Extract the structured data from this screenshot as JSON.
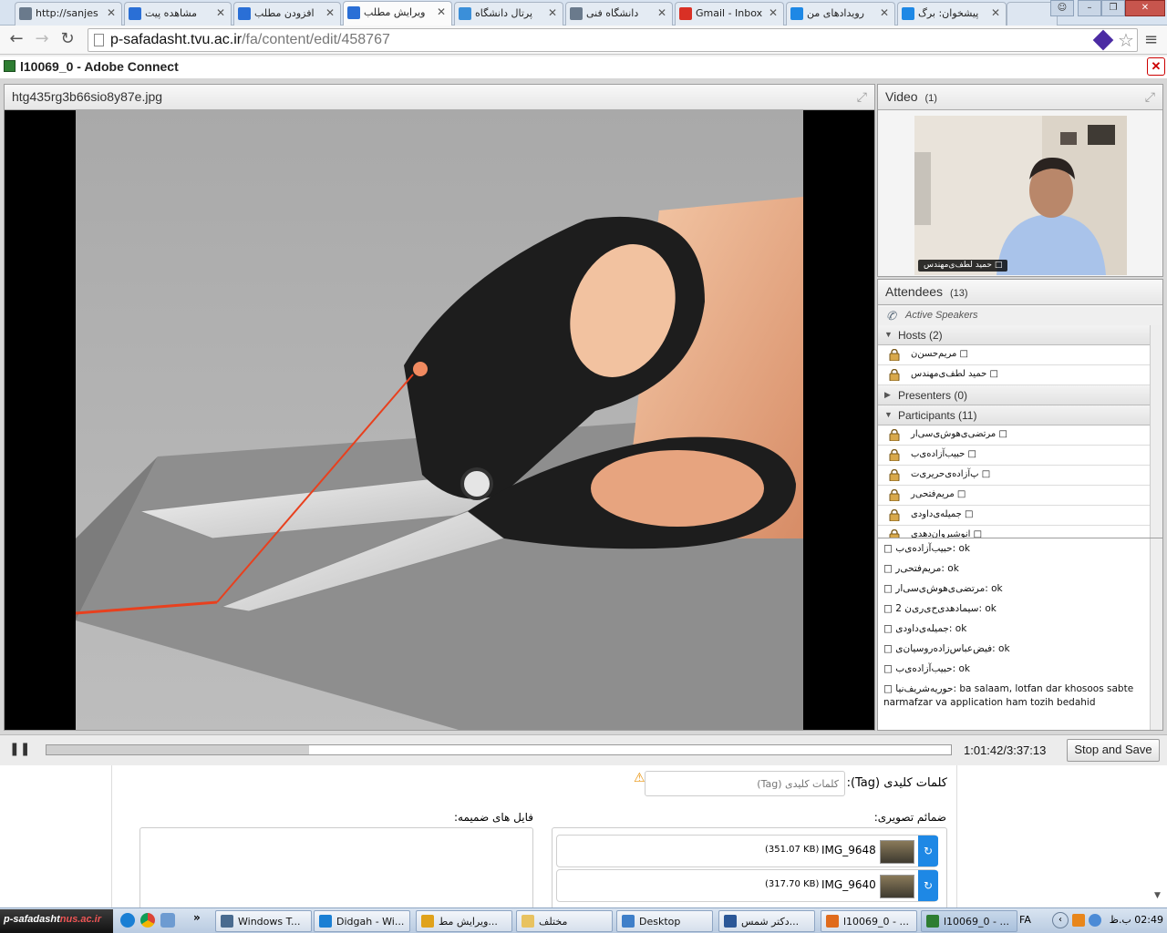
{
  "browser": {
    "tabs": [
      {
        "label": "http://sanjes",
        "icon": "page-icon",
        "color": "#6a7a8c"
      },
      {
        "label": "مشاهده پیت",
        "icon": "site-logo-icon",
        "color": "#2a6fd6"
      },
      {
        "label": "افزودن مطلب",
        "icon": "site-logo-icon",
        "color": "#2a6fd6"
      },
      {
        "label": "ویرایش مطلب",
        "icon": "site-logo-icon",
        "color": "#2a6fd6",
        "active": true
      },
      {
        "label": "پرتال دانشگاه",
        "icon": "portal-icon",
        "color": "#3b8fd9"
      },
      {
        "label": "دانشگاه فنی",
        "icon": "page-icon",
        "color": "#6a7a8c"
      },
      {
        "label": "Gmail - Inbox",
        "icon": "gmail-icon",
        "color": "#d93025"
      },
      {
        "label": "رویدادهای من",
        "icon": "e-icon",
        "color": "#1e88e5"
      },
      {
        "label": "پیشخوان: برگ",
        "icon": "e-icon",
        "color": "#1e88e5"
      }
    ],
    "url_host": "p-safadasht.tvu.ac.ir",
    "url_path": "/fa/content/edit/458767"
  },
  "connect": {
    "window_title": "l10069_0 - Adobe Connect",
    "share_pod_title": "htg435rg3b66sio8y87e.jpg",
    "video_pod_title": "Video",
    "video_count": "(1)",
    "video_name": "حمید لطف‌ی‌مهندس □",
    "attendees_title": "Attendees",
    "attendees_count": "(13)",
    "active_speakers": "Active Speakers",
    "hosts_label": "Hosts (2)",
    "hosts": [
      "مریم‌حسن‌ن □",
      "حمید لطف‌ی‌مهندس □"
    ],
    "presenters_label": "Presenters (0)",
    "participants_label": "Participants (11)",
    "participants": [
      "مرتضی‌ی‌هوش‌ی‌سی‌ار □",
      "حبیب‌آزاده‌ی‌ب □",
      "پ‌آزاده‌ی‌حریری‌ت □",
      "مریم‌فتحی‌ر □",
      "جمیله‌ی‌داود‌ی □",
      "انوشیروان‌دهدی □"
    ],
    "chat": [
      "□ حبیب‌آزاده‌ی‌ب: ok",
      "□ مریم‌فتحی‌ر: ok",
      "□ مرتضی‌ی‌هوش‌ی‌سی‌ار: ok",
      "□ سیما‌دهدی‌ح‌ی‌ری‌ن 2: ok",
      "□ جمیله‌ی‌داود‌ی: ok",
      "□ فیض‌عباس‌زاده‌روسیان‌ی: ok",
      "□ حبیب‌آزاده‌ی‌ب: ok",
      "□ حوریه‌شریف‌نیا: ba salaam, lotfan dar khosoos sabte narmafzar va application ham tozih bedahid"
    ],
    "time": "1:01:42/3:37:13",
    "playback_progress": 0.29,
    "stop_save_label": "Stop and Save"
  },
  "webpage": {
    "tags_label": "کلمات کلیدی (Tag):",
    "tags_placeholder": "کلمات کلیدی (Tag)",
    "images_label": "ضمائم تصویری:",
    "files_label": "فایل های ضمیمه:",
    "images": [
      {
        "name": "IMG_9648",
        "size": "(351.07 KB)"
      },
      {
        "name": "IMG_9640",
        "size": "(317.70 KB)"
      }
    ]
  },
  "taskbar": {
    "tray_label": "p-safadasht",
    "tray_label_suffix": "nus.ac.ir",
    "items": [
      {
        "label": "Windows T...",
        "icon": "task-manager-icon",
        "color": "#4a6b8f"
      },
      {
        "label": "Didgah - Wi...",
        "icon": "ie-icon",
        "color": "#1a7fd4"
      },
      {
        "label": "ویرایش مط...",
        "icon": "chrome-icon",
        "color": "#e0a21b"
      },
      {
        "label": "مختلف",
        "icon": "folder-icon",
        "color": "#e8c260"
      },
      {
        "label": "Desktop",
        "icon": "desktop-icon",
        "color": "#3f7fc9"
      },
      {
        "label": "دکتر شمس...",
        "icon": "word-icon",
        "color": "#2b5797"
      },
      {
        "label": "l10069_0 - ...",
        "icon": "firefox-icon",
        "color": "#e06b1c"
      },
      {
        "label": "l10069_0 - ...",
        "icon": "adobe-connect-icon",
        "color": "#2e7d32",
        "active": true
      }
    ],
    "lang": "FA",
    "clock": "02:49 ب.ظ"
  }
}
